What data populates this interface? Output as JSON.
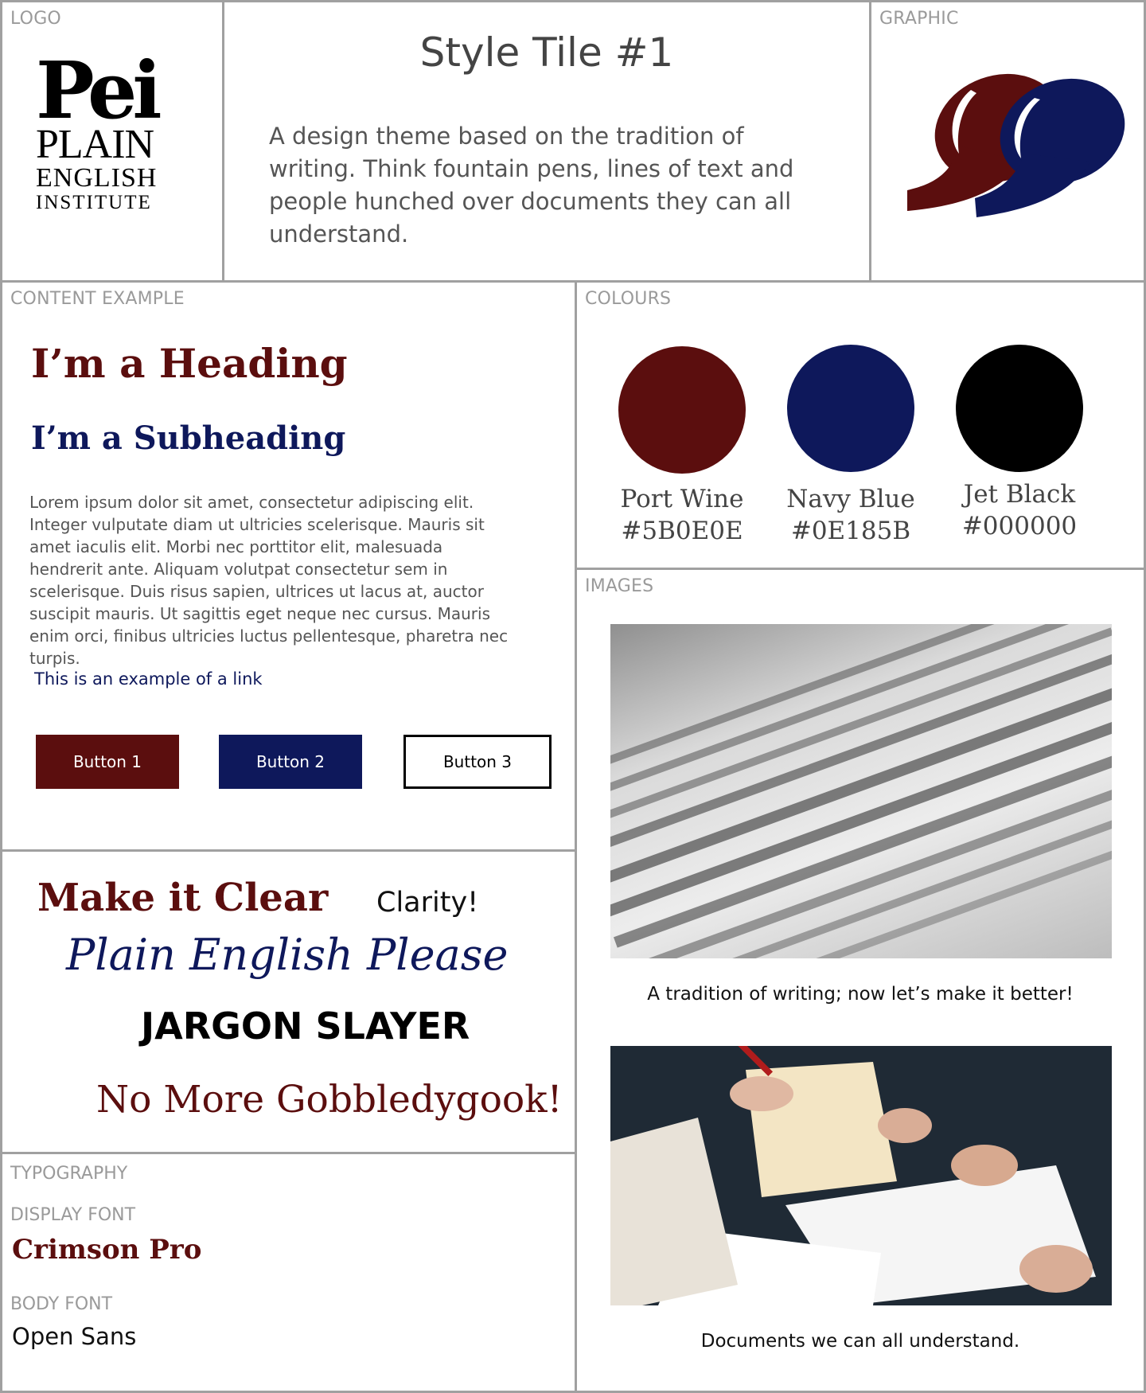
{
  "colors": {
    "port_wine": "#5B0E0E",
    "navy_blue": "#0E185B",
    "jet_black": "#000000",
    "border": "#a0a0a0",
    "label": "#9a9a9a"
  },
  "logo": {
    "section_label": "LOGO",
    "mark": "Pei",
    "line1": "PLAIN",
    "line2": "ENGLISH",
    "line3": "INSTITUTE"
  },
  "intro": {
    "title": "Style Tile #1",
    "description": "A design theme based on the tradition of writing. Think fountain pens, lines of text and people hunched over documents they can all understand."
  },
  "graphic": {
    "section_label": "GRAPHIC",
    "icon": "quote-marks-icon"
  },
  "content_example": {
    "section_label": "CONTENT EXAMPLE",
    "heading": "I’m a Heading",
    "subheading": "I’m a Subheading",
    "body": "Lorem ipsum dolor sit amet, consectetur adipiscing elit. Integer vulputate diam ut ultricies scelerisque. Mauris sit amet iaculis elit. Morbi nec porttitor elit, malesuada hendrerit ante. Aliquam volutpat consectetur sem in scelerisque. Duis risus sapien, ultrices ut lacus at, auctor suscipit mauris. Ut sagittis eget neque nec cursus. Mauris enim orci, finibus ultricies luctus pellentesque, pharetra nec turpis.",
    "link": "This is an example of a link",
    "buttons": [
      "Button 1",
      "Button 2",
      "Button 3"
    ]
  },
  "expressions": {
    "make_it_clear": "Make it Clear",
    "clarity": "Clarity!",
    "plain_english": "Plain English Please",
    "jargon": "JARGON SLAYER",
    "gobbledygook": "No More Gobbledygook!"
  },
  "typography": {
    "section_label": "TYPOGRAPHY",
    "display_label": "DISPLAY FONT",
    "display_font": "Crimson Pro",
    "body_label": "BODY FONT",
    "body_font": "Open Sans"
  },
  "colours": {
    "section_label": "COLOURS",
    "swatches": [
      {
        "name": "Port Wine",
        "hex": "#5B0E0E",
        "label_hex": "#5B0E0E"
      },
      {
        "name": "Navy Blue",
        "hex": "#0E185B",
        "label_hex": "#0E185B"
      },
      {
        "name": "Jet Black",
        "hex": "#000000",
        "label_hex": "#000000"
      }
    ]
  },
  "images": {
    "section_label": "IMAGES",
    "caption1": "A tradition of writing; now let’s make it better!",
    "caption2": "Documents we can all understand."
  }
}
